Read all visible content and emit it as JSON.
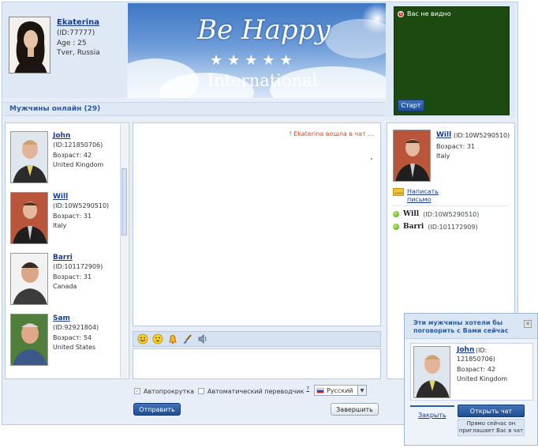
{
  "profile": {
    "name": "Ekaterina",
    "id": "(ID:77777)",
    "age": "Age : 25",
    "location": "Tver, Russia"
  },
  "banner": {
    "title": "Be Happy",
    "stars": "★★★★★",
    "subtitle": "International"
  },
  "video": {
    "status": "Вас не видно",
    "start_label": "Старт"
  },
  "online": {
    "title": "Мужчины онлайн (29)"
  },
  "men": [
    {
      "name": "John",
      "id": "(ID:121850706)",
      "age": "Возраст: 42",
      "country": "United Kingdom"
    },
    {
      "name": "Will",
      "id": "(ID:10W5290510)",
      "age": "Возраст: 31",
      "country": "Italy"
    },
    {
      "name": "Barri",
      "id": "(ID:101172909)",
      "age": "Возраст: 31",
      "country": "Canada"
    },
    {
      "name": "Sam",
      "id": "(ID:92921804)",
      "age": "Возраст: 54",
      "country": "United States"
    }
  ],
  "chat": {
    "message": "! Ekaterina вошла в чат ..."
  },
  "options": {
    "autoscroll": "Автопрокрутка",
    "autotranslate": "Автоматический переводчик",
    "help": "?",
    "language": "Русский"
  },
  "buttons": {
    "send": "Отправить",
    "end": "Завершить"
  },
  "right_panel": {
    "name": "Will",
    "id": "(ID:10W5290510)",
    "age": "Возраст: 31",
    "country": "Italy",
    "write_line1": "Написать",
    "write_line2": "письмо",
    "online_list": [
      {
        "name": "Will",
        "id": "(ID:10W5290510)"
      },
      {
        "name": "Barri",
        "id": "(ID:101172909)"
      }
    ]
  },
  "popup": {
    "title": "Эти мужчины хотели бы поговорить с Вами сейчас",
    "name": "John",
    "id_part1": "(ID:",
    "id_part2": "121850706)",
    "age": "Возраст: 42",
    "country": "United Kingdom",
    "close_label": "Закрыть",
    "open_chat_label": "Открыть чат",
    "note": "Прямо сейчас он приглашает Вас в чат"
  },
  "colors": {
    "accent": "#2b5da8",
    "link": "#1a3d8f",
    "video_bg": "#1d4a11",
    "system_message": "#e04a1a",
    "online_dot": "#4d9b12"
  }
}
